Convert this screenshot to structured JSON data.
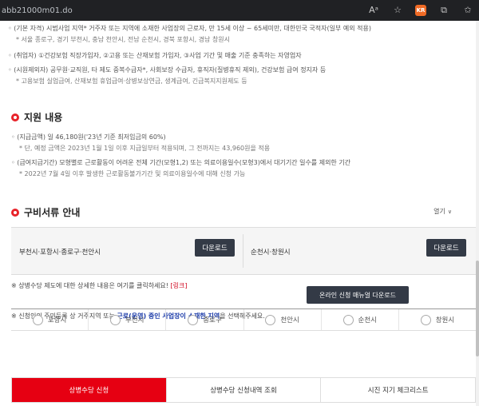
{
  "browser": {
    "url": "abb21000m01.do",
    "icons": [
      "reader-icon",
      "favorite-icon",
      "extension-badge",
      "extensions-icon",
      "favorites-bar-icon"
    ],
    "extension_label": "KR"
  },
  "eligibility": {
    "line1": "◦ (기본 자격) 시범사업 지역* 거주자 또는 지역에 소재한 사업장의 근로자, 만 15세 이상 ~ 65세미만, 대한민국 국적자(일부 예외 적용)",
    "line2": "* 서울 종로구, 경기 부천시, 충남 천안시, 전남 순천시, 경북 포항시, 경남 창원시",
    "line3": "◦ (취업자) ①건강보험 직장가입자, ②고용 또는 산재보험 가입자, ③사업 기간 및 매출 기준 충족하는 자영업자",
    "line4": "◦ (시원제외자) 공무원·교직원, 타 제도 중복수급자*, 사회보장 수급자, 휴직자(질병휴직 제외), 건강보험 급여 정지자 등",
    "line5": "* 고용보험 실업급여, 산재보험 휴업급여·상병보상연금, 생계급여, 긴급복지지원제도 등"
  },
  "support": {
    "title": "지원 내용",
    "line1": "◦ (지급금액) 일 46,180원('23년 기준 최저임금의 60%)",
    "line2": "* 단, 예정 금액은 2023년 1월 1일 이후 지급일부터 적용되며, 그 전까지는 43,960원을 적용",
    "line3": "◦ (급여지급기간) 모형별로 근로활동이 어려운 전체 기간(모형1,2) 또는 의료이용일수(모형3)에서 대기기간 일수를 제외한 기간",
    "line4": "* 2022년 7월 4일 이후 발생한 근로활동불가기간 및 의료이용일수에 대해 신청 가능"
  },
  "documents": {
    "title": "구비서류 안내",
    "toggle_label": "열기",
    "left_label": "부천시·포항시·종로구·천안시",
    "right_label": "순천시·창원시",
    "download_label": "다운로드"
  },
  "notices": {
    "detail_text": "※ 상병수당 제도에 대한 상세한 내용은 여기를 클릭하세요! ",
    "detail_link": "[링크]",
    "region_prefix": "※ 신청인의 주민등록 상 거주지역 또는 ",
    "region_highlight": "근로(운영) 중인 사업장이 소재한 지역",
    "region_suffix": "을 선택해주세요.",
    "manual_button": "온라인 신청 매뉴얼 다운로드"
  },
  "regions": [
    "포항시",
    "부천시",
    "종로구",
    "천안시",
    "순천시",
    "창원시"
  ],
  "tabs": [
    "상병수당 신청",
    "상병수당 신청내역 조회",
    "시진 지기 체크리스트"
  ],
  "colors": {
    "accent": "#e60012",
    "dark_button": "#333a46",
    "link_blue": "#1a3aa8"
  }
}
